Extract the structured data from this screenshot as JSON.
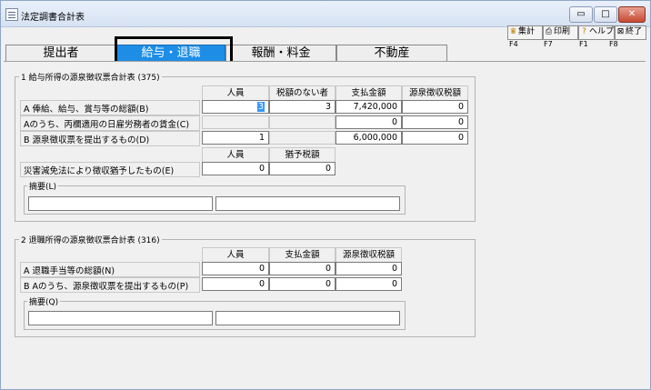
{
  "window": {
    "title": "法定調書合計表",
    "controls": {
      "minimize": "▭",
      "maximize": "□",
      "close": "✕"
    }
  },
  "toolbar": {
    "buttons": [
      {
        "icon": "totals-icon",
        "label": "集計",
        "key": "F4"
      },
      {
        "icon": "print-icon",
        "label": "印刷",
        "key": "F7"
      },
      {
        "icon": "help-icon",
        "label": "ヘルプ",
        "key": "F1"
      },
      {
        "icon": "exit-icon",
        "label": "終了",
        "key": "F8"
      }
    ]
  },
  "tabs": [
    {
      "label": "提出者",
      "active": false
    },
    {
      "label": "給与・退職",
      "active": true
    },
    {
      "label": "報酬・料金",
      "active": false
    },
    {
      "label": "不動産",
      "active": false
    }
  ],
  "section1": {
    "title": "1 給与所得の源泉徴収票合計表 (375)",
    "headers": [
      "人員",
      "税額のない者",
      "支払金額",
      "源泉徴収税額"
    ],
    "rows": [
      {
        "label": "A 俸給、給与、賞与等の総額(B)",
        "values": [
          "3",
          "3",
          "7,420,000",
          "0"
        ]
      },
      {
        "label": "Aのうち、丙欄適用の日雇労務者の賃金(C)",
        "values": [
          "",
          "",
          "0",
          "0"
        ]
      },
      {
        "label": "B 源泉徴収票を提出するもの(D)",
        "values": [
          "1",
          "",
          "6,000,000",
          "0"
        ]
      }
    ],
    "sub_headers": [
      "人員",
      "猶予税額"
    ],
    "disaster_row": {
      "label": "災害減免法により徴収猶予したもの(E)",
      "values": [
        "0",
        "0"
      ]
    },
    "memo_label": "摘要(L)"
  },
  "section2": {
    "title": "2 退職所得の源泉徴収票合計表 (316)",
    "headers": [
      "人員",
      "支払金額",
      "源泉徴収税額"
    ],
    "rows": [
      {
        "label": "A 退職手当等の総額(N)",
        "values": [
          "0",
          "0",
          "0"
        ]
      },
      {
        "label": "B Aのうち、源泉徴収票を提出するもの(P)",
        "values": [
          "0",
          "0",
          "0"
        ]
      }
    ],
    "memo_label": "摘要(Q)"
  }
}
